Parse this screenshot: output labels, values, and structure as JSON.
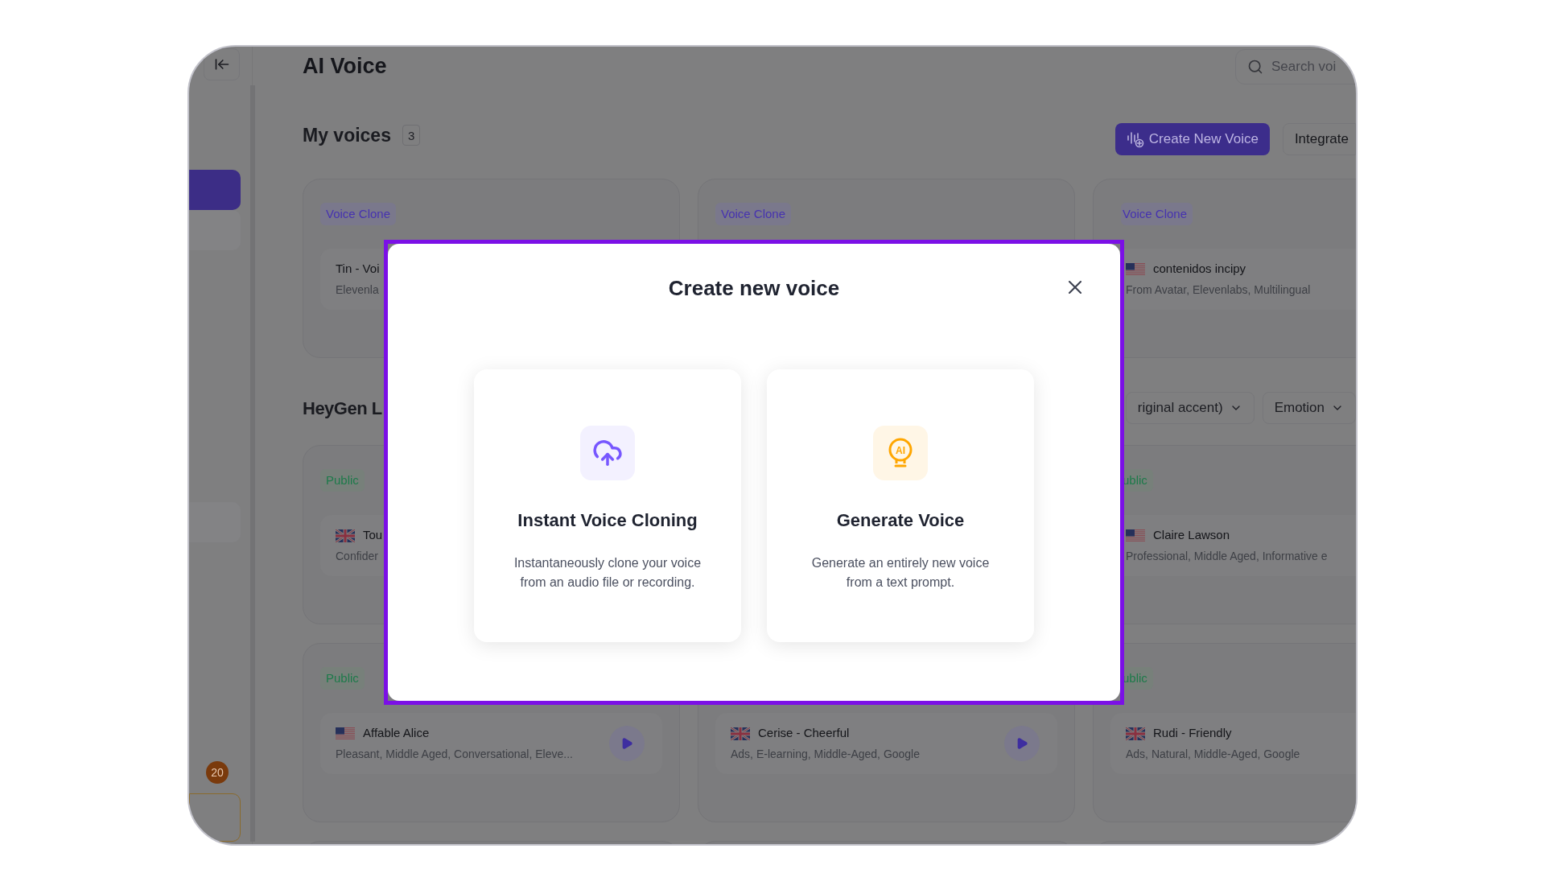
{
  "sidebar": {
    "items": [
      {
        "selected": true
      },
      {
        "selected": false
      },
      {
        "selected": false
      }
    ],
    "badge": "20"
  },
  "header": {
    "title": "AI Voice",
    "search": {
      "placeholder": "Search voi"
    }
  },
  "my_voices": {
    "title": "My voices",
    "count": "3",
    "buttons": [
      {
        "label": "Create New Voice",
        "kind": "primary"
      },
      {
        "label": "Integrate",
        "kind": "secondary"
      }
    ],
    "cards": [
      {
        "tag": {
          "label": "Voice Clone",
          "kind": "clone"
        },
        "name": "Tin - Voi",
        "description": "Elevenla"
      },
      {
        "tag": {
          "label": "Voice Clone",
          "kind": "clone"
        }
      },
      {
        "tag": {
          "label": "Voice Clone",
          "kind": "clone"
        },
        "flag": {
          "kind": "us"
        },
        "name": "contenidos incipy",
        "description": "From Avatar, Elevenlabs, Multilingual"
      }
    ]
  },
  "library": {
    "title": "HeyGen L",
    "filters": [
      "riginal accent)",
      "Emotion"
    ],
    "rows": [
      [
        {
          "tag": {
            "label": "Public",
            "kind": "public"
          },
          "flag": {
            "kind": "gb"
          },
          "name": "Tou",
          "description": "Confider"
        },
        {},
        {
          "tag": {
            "label": "ublic",
            "kind": "public"
          },
          "flag": {
            "kind": "us"
          },
          "name": "Claire Lawson",
          "description": "Professional, Middle Aged, Informative e"
        }
      ],
      [
        {
          "tag": {
            "label": "Public",
            "kind": "public"
          },
          "flag": {
            "kind": "us"
          },
          "name": "Affable Alice",
          "description": "Pleasant, Middle Aged, Conversational, Eleve...",
          "play": true
        },
        {
          "flag": {
            "kind": "gb"
          },
          "name": "Cerise - Cheerful",
          "description": "Ads, E-learning, Middle-Aged, Google",
          "play": true
        },
        {
          "tag": {
            "label": "ublic",
            "kind": "public"
          },
          "flag": {
            "kind": "gb"
          },
          "name": "Rudi - Friendly",
          "description": "Ads, Natural, Middle-Aged, Google"
        }
      ],
      [
        {},
        {},
        {}
      ]
    ]
  },
  "modal": {
    "title": "Create new voice",
    "options": [
      {
        "kind": "clone",
        "title": "Instant Voice Cloning",
        "description": "Instantaneously clone your voice from an audio file or recording."
      },
      {
        "kind": "generate",
        "icon_text": "AI",
        "title": "Generate Voice",
        "description": "Generate an entirely new voice from a text prompt."
      }
    ]
  }
}
